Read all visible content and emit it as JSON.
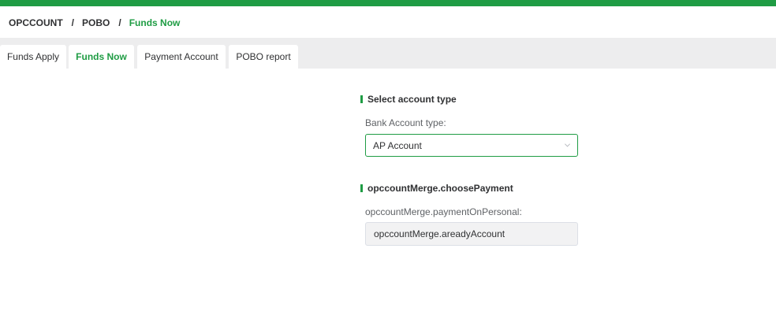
{
  "breadcrumb": {
    "items": [
      "OPCCOUNT",
      "POBO"
    ],
    "separator": "/",
    "current": "Funds Now"
  },
  "tabs": [
    {
      "label": "Funds Apply",
      "active": false
    },
    {
      "label": "Funds Now",
      "active": true
    },
    {
      "label": "Payment Account",
      "active": false
    },
    {
      "label": "POBO report",
      "active": false
    }
  ],
  "section_account": {
    "title": "Select account type",
    "label": "Bank Account type:",
    "selected": "AP Account",
    "icon": "chevron-down-icon"
  },
  "section_payment": {
    "title": "opccountMerge.choosePayment",
    "label": "opccountMerge.paymentOnPersonal:",
    "value": "opccountMerge.areadyAccount"
  },
  "colors": {
    "accent": "#1f9c44",
    "tab_bar_bg": "#ededee",
    "readonly_bg": "#f2f2f3"
  }
}
